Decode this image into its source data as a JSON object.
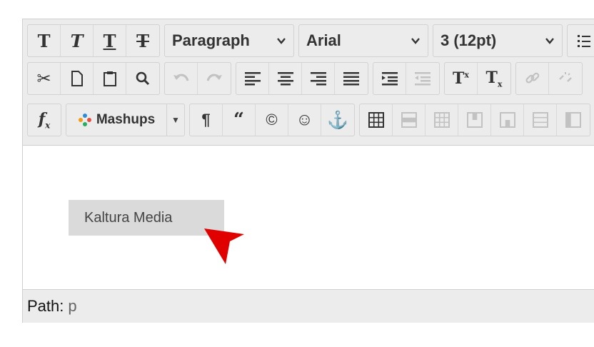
{
  "toolbar": {
    "block_format": "Paragraph",
    "font_family": "Arial",
    "font_size": "3 (12pt)",
    "mashups_label": "Mashups"
  },
  "content": {
    "menu_item": "Kaltura Media"
  },
  "pathbar": {
    "label": "Path:",
    "value": "p"
  },
  "colors": {
    "toolbar_bg": "#ececec",
    "menu_item_bg": "#dadada",
    "pointer_arrow": "#e00000"
  }
}
